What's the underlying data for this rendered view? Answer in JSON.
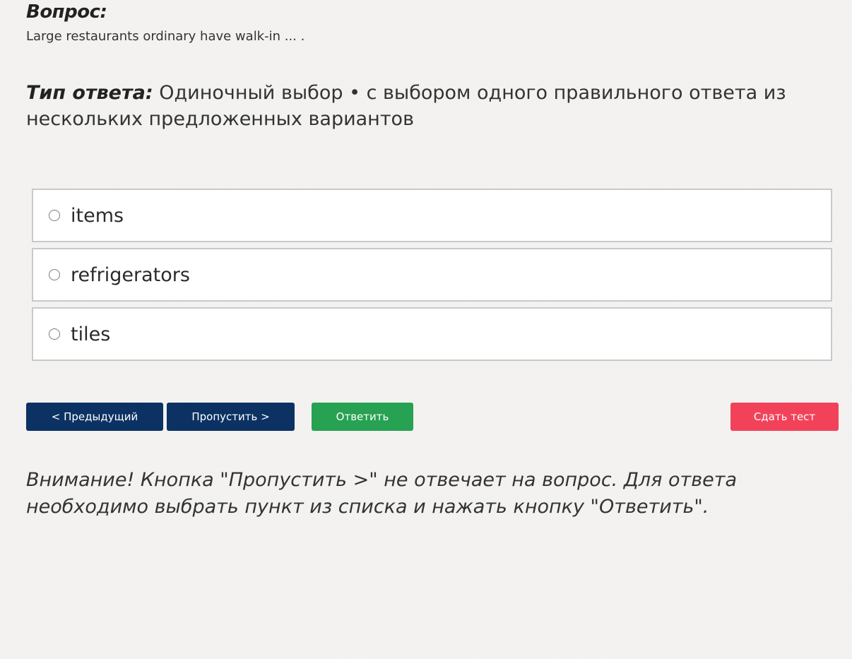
{
  "question": {
    "label": "Вопрос:",
    "text": "Large restaurants ordinary have walk-in ... ."
  },
  "answer_type": {
    "label": "Тип ответа:",
    "value": "Одиночный выбор • с выбором одного правильного ответа из нескольких предложенных вариантов"
  },
  "options": [
    {
      "label": "items",
      "selected": false
    },
    {
      "label": "refrigerators",
      "selected": false
    },
    {
      "label": "tiles",
      "selected": false
    }
  ],
  "buttons": {
    "previous": "< Предыдущий",
    "skip": "Пропустить >",
    "answer": "Ответить",
    "finish": "Сдать тест"
  },
  "colors": {
    "navy_button": "#0c3263",
    "answer_button": "#27a152",
    "finish_button": "#f2425a",
    "background": "#f2f1ef"
  },
  "warning": "Внимание! Кнопка \"Пропустить >\" не отвечает на вопрос. Для ответа необходимо выбрать пункт из списка и нажать кнопку \"Ответить\"."
}
